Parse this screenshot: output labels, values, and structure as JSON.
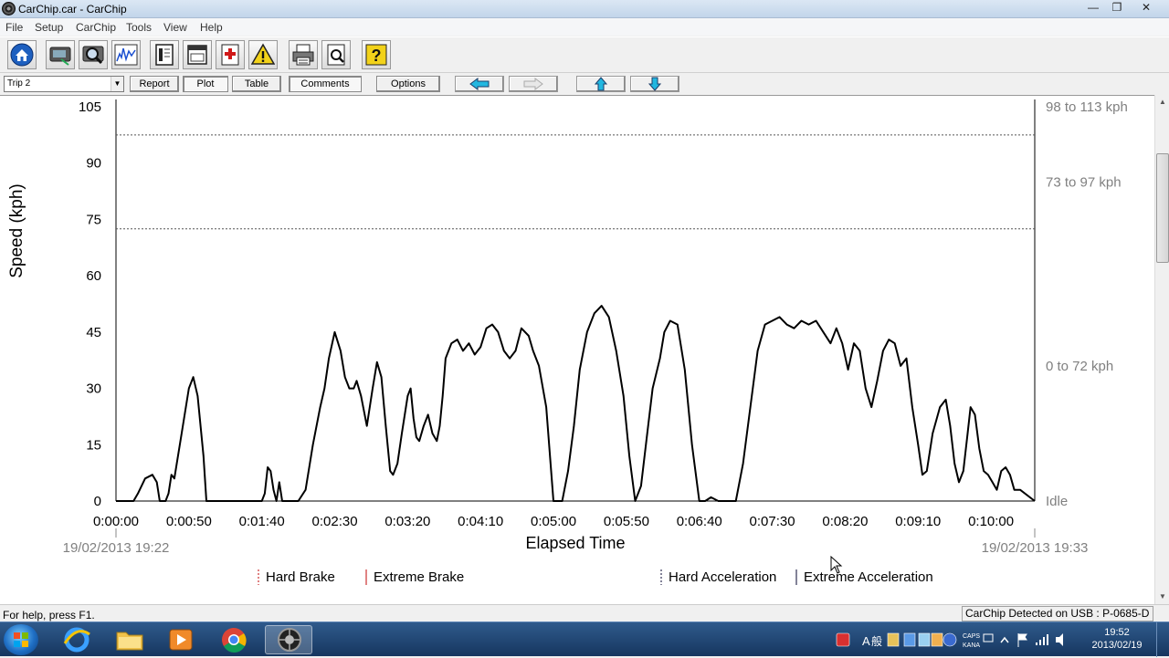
{
  "window": {
    "title": "CarChip.car - CarChip",
    "controls": {
      "minimize": "—",
      "maximize": "❐",
      "close": "✕"
    }
  },
  "menu": [
    "File",
    "Setup",
    "CarChip",
    "Tools",
    "View",
    "Help"
  ],
  "toolbar_icons": [
    "home-icon",
    "download-icon",
    "search-icon",
    "graph-icon",
    "report-icon",
    "window-icon",
    "first-aid-icon",
    "warning-icon",
    "print-icon",
    "print-preview-icon",
    "help-icon"
  ],
  "controls": {
    "trip_select": "Trip 2",
    "buttons": {
      "report": "Report",
      "plot": "Plot",
      "table": "Table",
      "comments": "Comments",
      "options": "Options"
    },
    "nav_icons": [
      "left-arrow-icon",
      "right-arrow-icon",
      "up-arrow-icon",
      "down-arrow-icon"
    ]
  },
  "chart_data": {
    "type": "line",
    "ylabel": "Speed (kph)",
    "xlabel": "Elapsed Time",
    "ylim": [
      0,
      105
    ],
    "yticks": [
      "105",
      "90",
      "75",
      "60",
      "45",
      "30",
      "15",
      "0"
    ],
    "ytick_values": [
      105,
      90,
      75,
      60,
      45,
      30,
      15,
      0
    ],
    "xlim": [
      0,
      630
    ],
    "xticks": [
      "0:00:00",
      "0:00:50",
      "0:01:40",
      "0:02:30",
      "0:03:20",
      "0:04:10",
      "0:05:00",
      "0:05:50",
      "0:06:40",
      "0:07:30",
      "0:08:20",
      "0:09:10",
      "0:10:00"
    ],
    "xtick_values": [
      0,
      50,
      100,
      150,
      200,
      250,
      300,
      350,
      400,
      450,
      500,
      550,
      600
    ],
    "start_time": "19/02/2013 19:22",
    "end_time": "19/02/2013 19:33",
    "bands": [
      {
        "label": "98 to 113 kph",
        "at": 105,
        "line": 97.5
      },
      {
        "label": "73 to 97 kph",
        "at": 85,
        "line": 72.5
      },
      {
        "label": "0 to 72 kph",
        "at": 36
      },
      {
        "label": "Idle",
        "at": 0
      }
    ],
    "legend": [
      {
        "label": "Hard Brake",
        "style": "dotted",
        "color": "#d04040"
      },
      {
        "label": "Extreme Brake",
        "style": "solid",
        "color": "#d04040"
      },
      {
        "label": "Hard Acceleration",
        "style": "dotted",
        "color": "#404060"
      },
      {
        "label": "Extreme Acceleration",
        "style": "solid",
        "color": "#404060"
      }
    ],
    "line_color": "#000000",
    "x": [
      0,
      12,
      15,
      20,
      25,
      28,
      30,
      34,
      36,
      38,
      40,
      45,
      50,
      53,
      56,
      60,
      62,
      64,
      100,
      102,
      104,
      106,
      108,
      110,
      112,
      114,
      125,
      130,
      135,
      140,
      143,
      146,
      150,
      154,
      157,
      160,
      163,
      165,
      168,
      172,
      176,
      179,
      182,
      185,
      188,
      190,
      193,
      196,
      200,
      202,
      204,
      206,
      208,
      211,
      214,
      217,
      220,
      222,
      224,
      226,
      230,
      234,
      238,
      242,
      246,
      250,
      254,
      258,
      262,
      266,
      270,
      274,
      278,
      283,
      286,
      290,
      295,
      300,
      306,
      310,
      314,
      318,
      323,
      328,
      333,
      338,
      343,
      348,
      352,
      356,
      360,
      364,
      368,
      373,
      376,
      380,
      385,
      390,
      395,
      400,
      404,
      408,
      413,
      417,
      420,
      425,
      430,
      435,
      440,
      445,
      450,
      455,
      460,
      465,
      470,
      475,
      480,
      485,
      490,
      494,
      498,
      502,
      506,
      510,
      514,
      518,
      522,
      526,
      530,
      534,
      538,
      542,
      546,
      550,
      553,
      556,
      560,
      565,
      569,
      572,
      575,
      578,
      581,
      584,
      586,
      589,
      592,
      595,
      598,
      601,
      604,
      607,
      610,
      613,
      616,
      620,
      630
    ],
    "y": [
      0,
      0,
      2,
      6,
      7,
      5,
      0,
      0,
      2,
      7,
      6,
      18,
      30,
      33,
      28,
      12,
      0,
      0,
      0,
      2,
      9,
      8,
      3,
      0,
      5,
      0,
      0,
      3,
      15,
      25,
      30,
      38,
      45,
      40,
      33,
      30,
      30,
      32,
      28,
      20,
      30,
      37,
      33,
      20,
      8,
      7,
      10,
      18,
      28,
      30,
      22,
      17,
      16,
      20,
      23,
      18,
      16,
      20,
      28,
      38,
      42,
      43,
      40,
      42,
      39,
      41,
      46,
      47,
      45,
      40,
      38,
      40,
      46,
      44,
      40,
      36,
      25,
      0,
      0,
      8,
      20,
      35,
      45,
      50,
      52,
      49,
      40,
      28,
      12,
      0,
      4,
      17,
      30,
      38,
      45,
      48,
      47,
      35,
      15,
      0,
      0,
      1,
      0,
      0,
      0,
      0,
      10,
      25,
      40,
      47,
      48,
      49,
      47,
      46,
      48,
      47,
      48,
      45,
      42,
      46,
      42,
      35,
      42,
      40,
      30,
      25,
      32,
      40,
      43,
      42,
      36,
      38,
      25,
      15,
      7,
      8,
      18,
      25,
      27,
      20,
      10,
      5,
      8,
      18,
      25,
      23,
      14,
      8,
      7,
      5,
      3,
      8,
      9,
      7,
      3,
      3,
      0,
      0
    ]
  },
  "status": {
    "help": "For help, press F1.",
    "usb": "CarChip Detected on USB : P-0685-D"
  },
  "taskbar": {
    "apps": [
      "internet-explorer-icon",
      "folder-icon",
      "media-player-icon",
      "chrome-icon",
      "carchip-icon"
    ],
    "time": "19:52",
    "date": "2013/02/19",
    "tray_caps": "CAPS",
    "tray_kana": "KANA",
    "tray_lang": "A",
    "tray_ime": "般"
  }
}
